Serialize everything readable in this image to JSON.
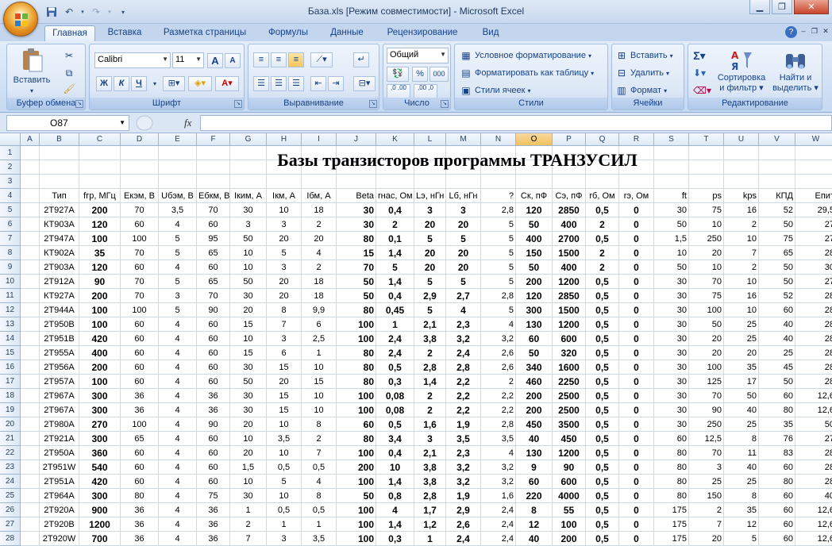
{
  "window": {
    "title": "База.xls  [Режим совместимости] - Microsoft Excel"
  },
  "tabs": [
    "Главная",
    "Вставка",
    "Разметка страницы",
    "Формулы",
    "Данные",
    "Рецензирование",
    "Вид"
  ],
  "active_tab": "Главная",
  "ribbon": {
    "clipboard": {
      "label": "Буфер обмена",
      "paste": "Вставить"
    },
    "font": {
      "label": "Шрифт",
      "name": "Calibri",
      "size": "11",
      "bold": "Ж",
      "italic": "К",
      "underline": "Ч",
      "grow": "A",
      "shrink": "A"
    },
    "alignment": {
      "label": "Выравнивание"
    },
    "number": {
      "label": "Число",
      "format": "Общий",
      "percent": "%",
      "thousands": "000",
      "inc_dec": ",0 ,00",
      "dec_dec": ",00 ,0"
    },
    "styles": {
      "label": "Стили",
      "conditional": "Условное форматирование",
      "as_table": "Форматировать как таблицу",
      "cell_styles": "Стили ячеек"
    },
    "cells": {
      "label": "Ячейки",
      "insert": "Вставить",
      "delete": "Удалить",
      "format": "Формат"
    },
    "editing": {
      "label": "Редактирование",
      "sort": "Сортировка",
      "sort2": "и фильтр",
      "find": "Найти и",
      "find2": "выделить"
    }
  },
  "formula_bar": {
    "name_box": "O87",
    "fx": "fx",
    "value": ""
  },
  "sheet": {
    "title": "Базы транзисторов программы ТРАНЗУСИЛ",
    "columns": [
      "A",
      "B",
      "C",
      "D",
      "E",
      "F",
      "G",
      "H",
      "I",
      "J",
      "K",
      "L",
      "M",
      "N",
      "O",
      "P",
      "Q",
      "R",
      "S",
      "T",
      "U",
      "V",
      "W"
    ],
    "selected_column": "O",
    "row_numbers": [
      "1",
      "2",
      "3",
      "4",
      "5",
      "6",
      "7",
      "8",
      "9",
      "10",
      "11",
      "12",
      "13",
      "14",
      "15",
      "16",
      "17",
      "18",
      "19",
      "20",
      "21",
      "22",
      "23",
      "24",
      "25",
      "26",
      "27",
      "28",
      "29"
    ],
    "headers": [
      "Тип",
      "fгр, МГц",
      "Eкэм, В",
      "Uбэм, В",
      "Eбкм, В",
      "Iким, А",
      "Iкм, А",
      "Iбм, А",
      "Beta",
      "rнас, Ом",
      "Lэ, нГн",
      "Lб, нГн",
      "?",
      "Ск, пФ",
      "Сэ, пФ",
      "rб, Ом",
      "rэ, Ом",
      "ft",
      "ps",
      "kps",
      "КПД",
      "Епит"
    ],
    "rows": [
      [
        "2Т927А",
        "200",
        "70",
        "3,5",
        "70",
        "30",
        "10",
        "18",
        "30",
        "0,4",
        "3",
        "3",
        "2,8",
        "120",
        "2850",
        "0,5",
        "0",
        "30",
        "75",
        "16",
        "52",
        "29,5"
      ],
      [
        "КТ903А",
        "120",
        "60",
        "4",
        "60",
        "3",
        "3",
        "2",
        "30",
        "2",
        "20",
        "20",
        "5",
        "50",
        "400",
        "2",
        "0",
        "50",
        "10",
        "2",
        "50",
        "27"
      ],
      [
        "2Т947А",
        "100",
        "100",
        "5",
        "95",
        "50",
        "20",
        "20",
        "80",
        "0,1",
        "5",
        "5",
        "5",
        "400",
        "2700",
        "0,5",
        "0",
        "1,5",
        "250",
        "10",
        "75",
        "27"
      ],
      [
        "КТ902А",
        "35",
        "70",
        "5",
        "65",
        "10",
        "5",
        "4",
        "15",
        "1,4",
        "20",
        "20",
        "5",
        "150",
        "1500",
        "2",
        "0",
        "10",
        "20",
        "7",
        "65",
        "28"
      ],
      [
        "2Т903А",
        "120",
        "60",
        "4",
        "60",
        "10",
        "3",
        "2",
        "70",
        "5",
        "20",
        "20",
        "5",
        "50",
        "400",
        "2",
        "0",
        "50",
        "10",
        "2",
        "50",
        "30"
      ],
      [
        "2Т912А",
        "90",
        "70",
        "5",
        "65",
        "50",
        "20",
        "18",
        "50",
        "1,4",
        "5",
        "5",
        "5",
        "200",
        "1200",
        "0,5",
        "0",
        "30",
        "70",
        "10",
        "50",
        "27"
      ],
      [
        "КТ927А",
        "200",
        "70",
        "3",
        "70",
        "30",
        "20",
        "18",
        "50",
        "0,4",
        "2,9",
        "2,7",
        "2,8",
        "120",
        "2850",
        "0,5",
        "0",
        "30",
        "75",
        "16",
        "52",
        "28"
      ],
      [
        "2Т944А",
        "100",
        "100",
        "5",
        "90",
        "20",
        "8",
        "9,9",
        "80",
        "0,45",
        "5",
        "4",
        "5",
        "300",
        "1500",
        "0,5",
        "0",
        "30",
        "100",
        "10",
        "60",
        "28"
      ],
      [
        "2Т950В",
        "100",
        "60",
        "4",
        "60",
        "15",
        "7",
        "6",
        "100",
        "1",
        "2,1",
        "2,3",
        "4",
        "130",
        "1200",
        "0,5",
        "0",
        "30",
        "50",
        "25",
        "40",
        "28"
      ],
      [
        "2Т951В",
        "420",
        "60",
        "4",
        "60",
        "10",
        "3",
        "2,5",
        "100",
        "2,4",
        "3,8",
        "3,2",
        "3,2",
        "60",
        "600",
        "0,5",
        "0",
        "30",
        "20",
        "25",
        "40",
        "28"
      ],
      [
        "2Т955А",
        "400",
        "60",
        "4",
        "60",
        "15",
        "6",
        "1",
        "80",
        "2,4",
        "2",
        "2,4",
        "2,6",
        "50",
        "320",
        "0,5",
        "0",
        "30",
        "20",
        "20",
        "25",
        "28"
      ],
      [
        "2Т956А",
        "200",
        "60",
        "4",
        "60",
        "30",
        "15",
        "10",
        "80",
        "0,5",
        "2,8",
        "2,8",
        "2,6",
        "340",
        "1600",
        "0,5",
        "0",
        "30",
        "100",
        "35",
        "45",
        "28"
      ],
      [
        "2Т957А",
        "100",
        "60",
        "4",
        "60",
        "50",
        "20",
        "15",
        "80",
        "0,3",
        "1,4",
        "2,2",
        "2",
        "460",
        "2250",
        "0,5",
        "0",
        "30",
        "125",
        "17",
        "50",
        "28"
      ],
      [
        "2Т967А",
        "300",
        "36",
        "4",
        "36",
        "30",
        "15",
        "10",
        "100",
        "0,08",
        "2",
        "2,2",
        "2,2",
        "200",
        "2500",
        "0,5",
        "0",
        "30",
        "70",
        "50",
        "60",
        "12,6"
      ],
      [
        "2Т967А",
        "300",
        "36",
        "4",
        "36",
        "30",
        "15",
        "10",
        "100",
        "0,08",
        "2",
        "2,2",
        "2,2",
        "200",
        "2500",
        "0,5",
        "0",
        "30",
        "90",
        "40",
        "80",
        "12,6"
      ],
      [
        "2Т980А",
        "270",
        "100",
        "4",
        "90",
        "20",
        "10",
        "8",
        "60",
        "0,5",
        "1,6",
        "1,9",
        "2,8",
        "450",
        "3500",
        "0,5",
        "0",
        "30",
        "250",
        "25",
        "35",
        "50"
      ],
      [
        "2Т921А",
        "300",
        "65",
        "4",
        "60",
        "10",
        "3,5",
        "2",
        "80",
        "3,4",
        "3",
        "3,5",
        "3,5",
        "40",
        "450",
        "0,5",
        "0",
        "60",
        "12,5",
        "8",
        "76",
        "27"
      ],
      [
        "2Т950А",
        "360",
        "60",
        "4",
        "60",
        "20",
        "10",
        "7",
        "100",
        "0,4",
        "2,1",
        "2,3",
        "4",
        "130",
        "1200",
        "0,5",
        "0",
        "80",
        "70",
        "11",
        "83",
        "28"
      ],
      [
        "2Т951W",
        "540",
        "60",
        "4",
        "60",
        "1,5",
        "0,5",
        "0,5",
        "200",
        "10",
        "3,8",
        "3,2",
        "3,2",
        "9",
        "90",
        "0,5",
        "0",
        "80",
        "3",
        "40",
        "60",
        "28"
      ],
      [
        "2Т951А",
        "420",
        "60",
        "4",
        "60",
        "10",
        "5",
        "4",
        "100",
        "1,4",
        "3,8",
        "3,2",
        "3,2",
        "60",
        "600",
        "0,5",
        "0",
        "80",
        "25",
        "25",
        "80",
        "28"
      ],
      [
        "2Т964А",
        "300",
        "80",
        "4",
        "75",
        "30",
        "10",
        "8",
        "50",
        "0,8",
        "2,8",
        "1,9",
        "1,6",
        "220",
        "4000",
        "0,5",
        "0",
        "80",
        "150",
        "8",
        "60",
        "40"
      ],
      [
        "2Т920А",
        "900",
        "36",
        "4",
        "36",
        "1",
        "0,5",
        "0,5",
        "100",
        "4",
        "1,7",
        "2,9",
        "2,4",
        "8",
        "55",
        "0,5",
        "0",
        "175",
        "2",
        "35",
        "60",
        "12,6"
      ],
      [
        "2Т920В",
        "1200",
        "36",
        "4",
        "36",
        "2",
        "1",
        "1",
        "100",
        "1,4",
        "1,2",
        "2,6",
        "2,4",
        "12",
        "100",
        "0,5",
        "0",
        "175",
        "7",
        "12",
        "60",
        "12,6"
      ],
      [
        "2Т920W",
        "700",
        "36",
        "4",
        "36",
        "7",
        "3",
        "3,5",
        "100",
        "0,3",
        "1",
        "2,4",
        "2,4",
        "40",
        "200",
        "0,5",
        "0",
        "175",
        "20",
        "5",
        "60",
        "12,6"
      ],
      [
        "2Т922А",
        "300",
        "65",
        "4",
        "60",
        "1,5",
        "0,8",
        "0,7",
        "150",
        "8",
        "1,7",
        "2,9",
        "2,4",
        "5",
        "100",
        "2",
        "0",
        "175",
        "5",
        "30",
        "55",
        "28"
      ]
    ]
  }
}
